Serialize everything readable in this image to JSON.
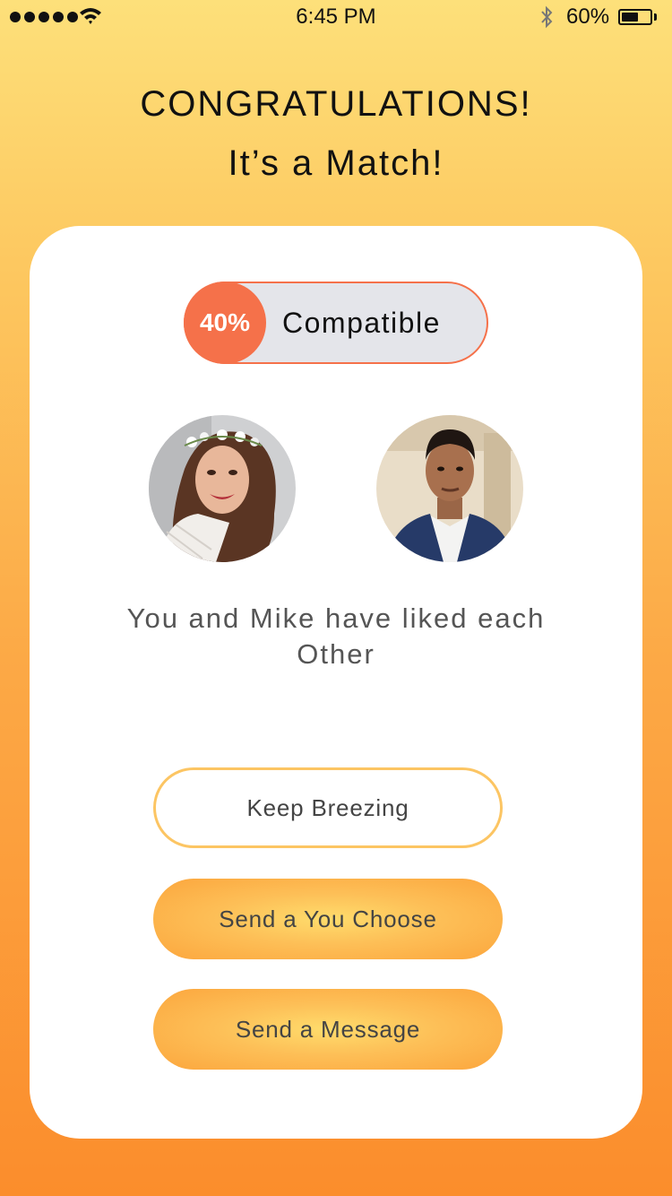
{
  "status_bar": {
    "time": "6:45 PM",
    "battery_percent": "60%",
    "battery_level": 0.6,
    "signal_dots": 5
  },
  "header": {
    "title": "CONGRATULATIONS!",
    "subtitle": "It’s a Match!"
  },
  "compatibility": {
    "percent": "40%",
    "label": "Compatible"
  },
  "match": {
    "message": "You and Mike have liked each Other"
  },
  "actions": {
    "keep_label": "Keep Breezing",
    "choose_label": "Send a You Choose",
    "message_label": "Send a Message"
  },
  "colors": {
    "accent": "#f5714a",
    "gradient_top": "#fde07a",
    "gradient_bottom": "#fb8d2c",
    "button_gold": "#fdbf57"
  }
}
